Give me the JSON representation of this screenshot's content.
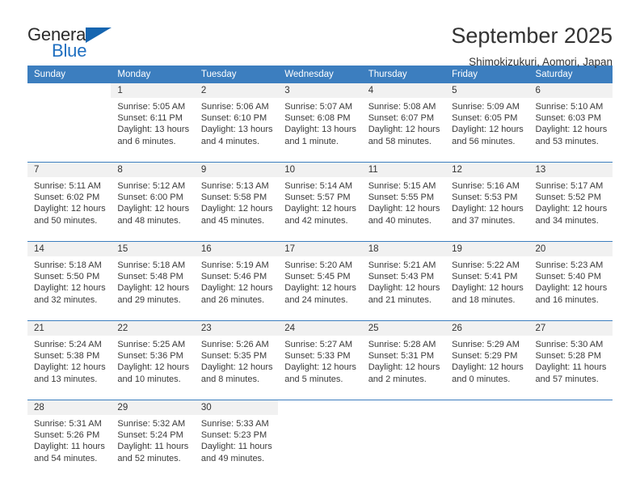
{
  "logo": {
    "word_top": "General",
    "word_bottom": "Blue",
    "triangle_icon": "triangle-icon",
    "color_dark": "#2b2b2b",
    "color_blue": "#1f6fc0"
  },
  "header": {
    "title": "September 2025",
    "subtitle": "Shimokizukuri, Aomori, Japan"
  },
  "theme": {
    "header_bg": "#3c7ebf",
    "daynum_bg": "#f1f1f1",
    "text": "#333333"
  },
  "calendar": {
    "weekdays": [
      "Sunday",
      "Monday",
      "Tuesday",
      "Wednesday",
      "Thursday",
      "Friday",
      "Saturday"
    ],
    "weeks": [
      [
        {
          "day": "",
          "sunrise": "",
          "sunset": "",
          "daylight": ""
        },
        {
          "day": "1",
          "sunrise": "Sunrise: 5:05 AM",
          "sunset": "Sunset: 6:11 PM",
          "daylight": "Daylight: 13 hours and 6 minutes."
        },
        {
          "day": "2",
          "sunrise": "Sunrise: 5:06 AM",
          "sunset": "Sunset: 6:10 PM",
          "daylight": "Daylight: 13 hours and 4 minutes."
        },
        {
          "day": "3",
          "sunrise": "Sunrise: 5:07 AM",
          "sunset": "Sunset: 6:08 PM",
          "daylight": "Daylight: 13 hours and 1 minute."
        },
        {
          "day": "4",
          "sunrise": "Sunrise: 5:08 AM",
          "sunset": "Sunset: 6:07 PM",
          "daylight": "Daylight: 12 hours and 58 minutes."
        },
        {
          "day": "5",
          "sunrise": "Sunrise: 5:09 AM",
          "sunset": "Sunset: 6:05 PM",
          "daylight": "Daylight: 12 hours and 56 minutes."
        },
        {
          "day": "6",
          "sunrise": "Sunrise: 5:10 AM",
          "sunset": "Sunset: 6:03 PM",
          "daylight": "Daylight: 12 hours and 53 minutes."
        }
      ],
      [
        {
          "day": "7",
          "sunrise": "Sunrise: 5:11 AM",
          "sunset": "Sunset: 6:02 PM",
          "daylight": "Daylight: 12 hours and 50 minutes."
        },
        {
          "day": "8",
          "sunrise": "Sunrise: 5:12 AM",
          "sunset": "Sunset: 6:00 PM",
          "daylight": "Daylight: 12 hours and 48 minutes."
        },
        {
          "day": "9",
          "sunrise": "Sunrise: 5:13 AM",
          "sunset": "Sunset: 5:58 PM",
          "daylight": "Daylight: 12 hours and 45 minutes."
        },
        {
          "day": "10",
          "sunrise": "Sunrise: 5:14 AM",
          "sunset": "Sunset: 5:57 PM",
          "daylight": "Daylight: 12 hours and 42 minutes."
        },
        {
          "day": "11",
          "sunrise": "Sunrise: 5:15 AM",
          "sunset": "Sunset: 5:55 PM",
          "daylight": "Daylight: 12 hours and 40 minutes."
        },
        {
          "day": "12",
          "sunrise": "Sunrise: 5:16 AM",
          "sunset": "Sunset: 5:53 PM",
          "daylight": "Daylight: 12 hours and 37 minutes."
        },
        {
          "day": "13",
          "sunrise": "Sunrise: 5:17 AM",
          "sunset": "Sunset: 5:52 PM",
          "daylight": "Daylight: 12 hours and 34 minutes."
        }
      ],
      [
        {
          "day": "14",
          "sunrise": "Sunrise: 5:18 AM",
          "sunset": "Sunset: 5:50 PM",
          "daylight": "Daylight: 12 hours and 32 minutes."
        },
        {
          "day": "15",
          "sunrise": "Sunrise: 5:18 AM",
          "sunset": "Sunset: 5:48 PM",
          "daylight": "Daylight: 12 hours and 29 minutes."
        },
        {
          "day": "16",
          "sunrise": "Sunrise: 5:19 AM",
          "sunset": "Sunset: 5:46 PM",
          "daylight": "Daylight: 12 hours and 26 minutes."
        },
        {
          "day": "17",
          "sunrise": "Sunrise: 5:20 AM",
          "sunset": "Sunset: 5:45 PM",
          "daylight": "Daylight: 12 hours and 24 minutes."
        },
        {
          "day": "18",
          "sunrise": "Sunrise: 5:21 AM",
          "sunset": "Sunset: 5:43 PM",
          "daylight": "Daylight: 12 hours and 21 minutes."
        },
        {
          "day": "19",
          "sunrise": "Sunrise: 5:22 AM",
          "sunset": "Sunset: 5:41 PM",
          "daylight": "Daylight: 12 hours and 18 minutes."
        },
        {
          "day": "20",
          "sunrise": "Sunrise: 5:23 AM",
          "sunset": "Sunset: 5:40 PM",
          "daylight": "Daylight: 12 hours and 16 minutes."
        }
      ],
      [
        {
          "day": "21",
          "sunrise": "Sunrise: 5:24 AM",
          "sunset": "Sunset: 5:38 PM",
          "daylight": "Daylight: 12 hours and 13 minutes."
        },
        {
          "day": "22",
          "sunrise": "Sunrise: 5:25 AM",
          "sunset": "Sunset: 5:36 PM",
          "daylight": "Daylight: 12 hours and 10 minutes."
        },
        {
          "day": "23",
          "sunrise": "Sunrise: 5:26 AM",
          "sunset": "Sunset: 5:35 PM",
          "daylight": "Daylight: 12 hours and 8 minutes."
        },
        {
          "day": "24",
          "sunrise": "Sunrise: 5:27 AM",
          "sunset": "Sunset: 5:33 PM",
          "daylight": "Daylight: 12 hours and 5 minutes."
        },
        {
          "day": "25",
          "sunrise": "Sunrise: 5:28 AM",
          "sunset": "Sunset: 5:31 PM",
          "daylight": "Daylight: 12 hours and 2 minutes."
        },
        {
          "day": "26",
          "sunrise": "Sunrise: 5:29 AM",
          "sunset": "Sunset: 5:29 PM",
          "daylight": "Daylight: 12 hours and 0 minutes."
        },
        {
          "day": "27",
          "sunrise": "Sunrise: 5:30 AM",
          "sunset": "Sunset: 5:28 PM",
          "daylight": "Daylight: 11 hours and 57 minutes."
        }
      ],
      [
        {
          "day": "28",
          "sunrise": "Sunrise: 5:31 AM",
          "sunset": "Sunset: 5:26 PM",
          "daylight": "Daylight: 11 hours and 54 minutes."
        },
        {
          "day": "29",
          "sunrise": "Sunrise: 5:32 AM",
          "sunset": "Sunset: 5:24 PM",
          "daylight": "Daylight: 11 hours and 52 minutes."
        },
        {
          "day": "30",
          "sunrise": "Sunrise: 5:33 AM",
          "sunset": "Sunset: 5:23 PM",
          "daylight": "Daylight: 11 hours and 49 minutes."
        },
        {
          "day": "",
          "sunrise": "",
          "sunset": "",
          "daylight": ""
        },
        {
          "day": "",
          "sunrise": "",
          "sunset": "",
          "daylight": ""
        },
        {
          "day": "",
          "sunrise": "",
          "sunset": "",
          "daylight": ""
        },
        {
          "day": "",
          "sunrise": "",
          "sunset": "",
          "daylight": ""
        }
      ]
    ]
  }
}
